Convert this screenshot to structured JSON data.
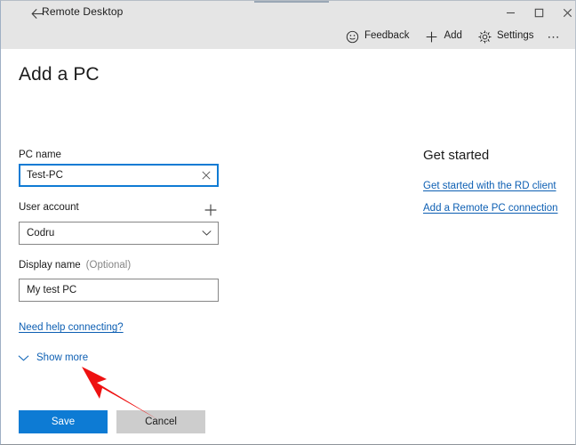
{
  "window": {
    "title": "Remote Desktop",
    "back_icon": "back-arrow-icon",
    "controls": {
      "minimize": "minimize-icon",
      "maximize": "maximize-icon",
      "close": "close-icon"
    }
  },
  "command_bar": {
    "items": [
      {
        "label": "Feedback",
        "icon": "smiley-feedback-icon"
      },
      {
        "label": "Add",
        "icon": "plus-icon"
      },
      {
        "label": "Settings",
        "icon": "gear-icon"
      }
    ],
    "overflow_label": "⋯",
    "overflow_icon": "ellipsis-icon"
  },
  "page": {
    "title": "Add a PC"
  },
  "form": {
    "pc_name": {
      "label": "PC name",
      "value": "Test-PC",
      "placeholder": "PC name",
      "clear_icon": "close-icon",
      "focused": true
    },
    "user_account": {
      "label": "User account",
      "value": "Codru",
      "add_icon": "plus-icon",
      "chevron_icon": "chevron-down-icon"
    },
    "display_name": {
      "label": "Display name",
      "optional_hint": "(Optional)",
      "value": "My test PC",
      "placeholder": "Display name"
    },
    "help_link": "Need help connecting?",
    "show_more": {
      "label": "Show more",
      "icon": "chevron-down-icon"
    }
  },
  "get_started": {
    "title": "Get started",
    "links": [
      "Get started with the RD client",
      "Add a Remote PC connection"
    ]
  },
  "actions": {
    "save_label": "Save",
    "cancel_label": "Cancel"
  },
  "annotation": {
    "type": "red-arrow",
    "points_to": "Show more"
  },
  "colors": {
    "accent": "#0d7bd4",
    "link": "#0d5fb3",
    "titlebar": "#e5e5e5",
    "content": "#ffffff",
    "cancel_button": "#cdcdcd",
    "annotation": "#ee1111",
    "focus_border": "#0f7bd4",
    "field_border": "#868686"
  }
}
